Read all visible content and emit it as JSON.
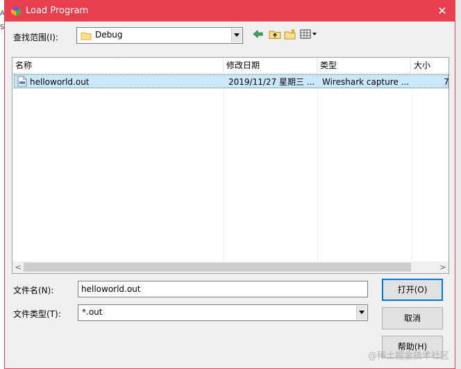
{
  "window": {
    "title": "Load Program"
  },
  "lookin": {
    "label": "查找范围(I):",
    "value": "Debug"
  },
  "list": {
    "columns": [
      "名称",
      "修改日期",
      "类型",
      "大小"
    ],
    "rows": [
      {
        "name": "helloworld.out",
        "date": "2019/11/27 星期三 ...",
        "type": "Wireshark capture ...",
        "size": "7"
      }
    ]
  },
  "filename": {
    "label": "文件名(N):",
    "value": "helloworld.out"
  },
  "filetype": {
    "label": "文件类型(T):",
    "value": "*.out"
  },
  "buttons": {
    "open": "打开(O)",
    "cancel": "取消",
    "help": "帮助(H)"
  },
  "watermark": "@稀土掘金技术社区",
  "colors": {
    "titlebar": "#e8404e",
    "selection": "#cce8ff",
    "default_button_border": "#0078d7"
  },
  "icons": [
    "app-icon",
    "close-icon",
    "folder-icon",
    "back-arrow-icon",
    "up-folder-icon",
    "new-folder-icon",
    "view-menu-icon",
    "file-icon"
  ]
}
